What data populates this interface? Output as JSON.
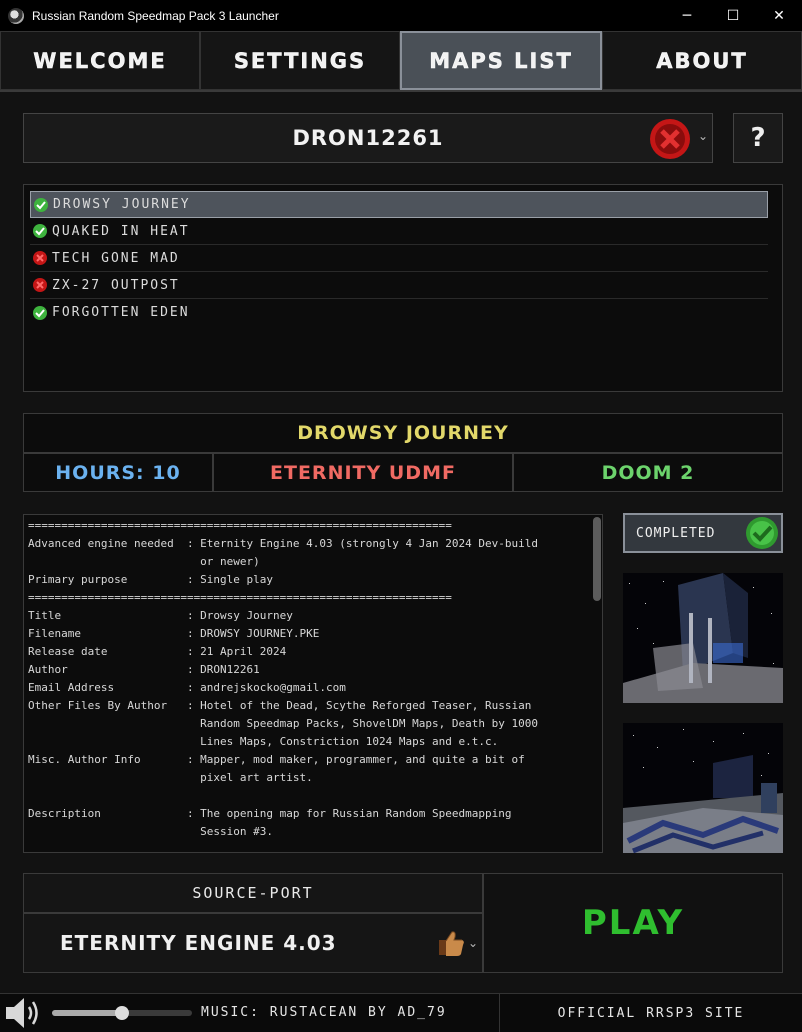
{
  "window": {
    "title": "Russian Random Speedmap Pack 3 Launcher",
    "minimize_glyph": "─",
    "maximize_glyph": "☐",
    "close_glyph": "✕"
  },
  "tabs": [
    {
      "label": "WELCOME",
      "active": false
    },
    {
      "label": "SETTINGS",
      "active": false
    },
    {
      "label": "MAPS LIST",
      "active": true
    },
    {
      "label": "ABOUT",
      "active": false
    }
  ],
  "player": {
    "name": "DRON12261",
    "status_icon": "fail-icon",
    "help_label": "?"
  },
  "maps": [
    {
      "label": "DROWSY JOURNEY",
      "status": "completed",
      "selected": true
    },
    {
      "label": "QUAKED IN HEAT",
      "status": "completed",
      "selected": false
    },
    {
      "label": "TECH GONE MAD",
      "status": "not-completed",
      "selected": false
    },
    {
      "label": "ZX-27 OUTPOST",
      "status": "not-completed",
      "selected": false
    },
    {
      "label": "FORGOTTEN EDEN",
      "status": "completed",
      "selected": false
    }
  ],
  "selected_map": {
    "title": "DROWSY JOURNEY",
    "hours": "HOURS: 10",
    "format": "ETERNITY UDMF",
    "game": "DOOM 2",
    "completed_label": "COMPLETED",
    "info_lines": [
      "================================================================",
      "Advanced engine needed  : Eternity Engine 4.03 (strongly 4 Jan 2024 Dev-build",
      "                          or newer)",
      "Primary purpose         : Single play",
      "================================================================",
      "Title                   : Drowsy Journey",
      "Filename                : DROWSY JOURNEY.PKE",
      "Release date            : 21 April 2024",
      "Author                  : DRON12261",
      "Email Address           : andrejskocko@gmail.com",
      "Other Files By Author   : Hotel of the Dead, Scythe Reforged Teaser, Russian",
      "                          Random Speedmap Packs, ShovelDM Maps, Death by 1000",
      "                          Lines Maps, Constriction 1024 Maps and e.t.c.",
      "Misc. Author Info       : Mapper, mod maker, programmer, and quite a bit of",
      "                          pixel art artist.",
      "",
      "Description             : The opening map for Russian Random Speedmapping",
      "                          Session #3."
    ]
  },
  "source_port": {
    "label": "SOURCE-PORT",
    "value": "ETERNITY ENGINE 4.03"
  },
  "play_label": "PLAY",
  "music": {
    "label": "MUSIC: RUSTACEAN BY AD_79",
    "volume": 0.5
  },
  "site_label": "OFFICIAL RRSP3 SITE",
  "colors": {
    "accent_green": "#2fbe2f",
    "map_title": "#e2d86a",
    "hours": "#6bb2f0",
    "format": "#f06a63",
    "game": "#6cd36c"
  }
}
